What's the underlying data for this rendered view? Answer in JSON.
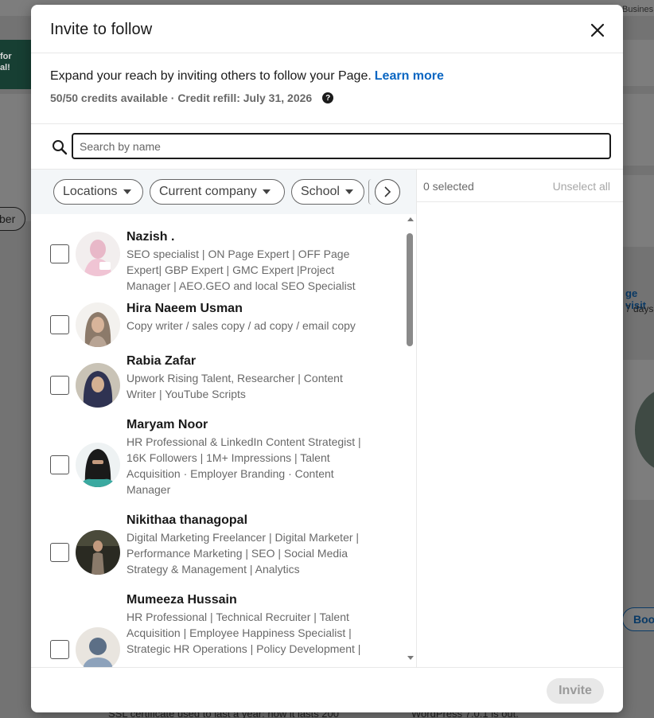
{
  "background": {
    "business_label": "Busines",
    "promo_text": "for\nal!",
    "left_pill": "ber",
    "visit_text": "ge visit",
    "days_text": "7 days",
    "right_pill": "Boo",
    "bottom_left_text": "SSL certificate used to last a year: how it lasts 200",
    "bottom_right_text": "WordPress 7.0.1 is out."
  },
  "modal": {
    "title": "Invite to follow",
    "close_icon": "close-icon",
    "description": "Expand your reach by inviting others to follow your Page.",
    "learn_more": "Learn more",
    "credits": "50/50 credits available · Credit refill: July 31, 2026",
    "help_glyph": "?",
    "search": {
      "placeholder": "Search by name",
      "value": ""
    },
    "filters": [
      {
        "label": "Locations"
      },
      {
        "label": "Current company"
      },
      {
        "label": "School"
      }
    ],
    "people": [
      {
        "name": "Nazish .",
        "headline": "SEO specialist | ON Page Expert | OFF Page Expert| GBP Expert | GMC Expert |Project Manager | AEO.GEO and local SEO Specialist"
      },
      {
        "name": "Hira Naeem Usman",
        "headline": "Copy writer / sales copy / ad copy / email copy"
      },
      {
        "name": "Rabia Zafar",
        "headline": "Upwork Rising Talent, Researcher | Content Writer | YouTube Scripts"
      },
      {
        "name": "Maryam Noor",
        "headline": "HR Professional & LinkedIn Content Strategist | 16K Followers | 1M+ Impressions | Talent Acquisition · Employer Branding · Content Manager"
      },
      {
        "name": "Nikithaa thanagopal",
        "headline": "Digital Marketing Freelancer | Digital Marketer | Performance Marketing | SEO | Social Media Strategy & Management | Analytics"
      },
      {
        "name": "Mumeeza Hussain",
        "headline": "HR Professional | Technical Recruiter | Talent Acquisition | Employee Happiness Specialist | Strategic HR Operations | Policy Development |"
      }
    ],
    "selected_count": "0 selected",
    "unselect_all": "Unselect all",
    "invite_label": "Invite"
  },
  "colors": {
    "brand_blue": "#0a66c2",
    "filter_bar": "#f3f6f8",
    "disabled_btn": "#e8e8e8"
  }
}
